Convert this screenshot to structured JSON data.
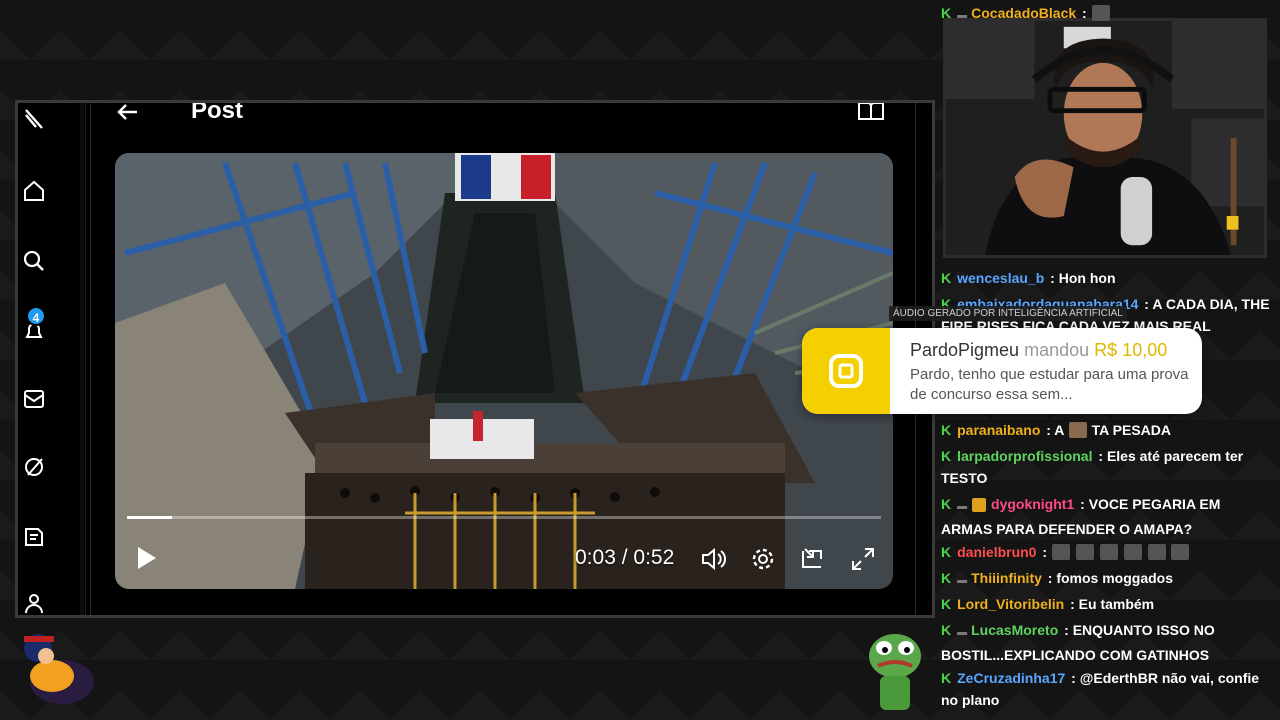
{
  "post": {
    "title": "Post",
    "notification_count": "4"
  },
  "video": {
    "current_time": "0:03",
    "duration": "0:52",
    "time_separator": " / ",
    "progress_fraction": 0.06
  },
  "alert": {
    "ai_label": "ÁUDIO GERADO POR INTELIGÊNCIA ARTIFICIAL",
    "sender": "PardoPigmeu",
    "verb": "mandou",
    "amount": "R$ 10,00",
    "message": "Pardo, tenho que estudar para uma prova de concurso essa sem..."
  },
  "chat": {
    "messages": [
      {
        "user": "CocadadoBlack",
        "color": "#f0b020",
        "text": "",
        "sub": true,
        "emotes": 1
      },
      {
        "user": "wenceslau_b",
        "color": "#58a6ff",
        "text": "Hon hon",
        "sub": false,
        "emotes": 0
      },
      {
        "user": "embaixadordaguanabara14",
        "color": "#58a6ff",
        "text": "A CADA DIA, THE FIRE RISES FICA CADA VEZ MAIS REAL",
        "sub": false,
        "emotes": 0
      },
      {
        "user": "paranaibano",
        "color": "#f0b020",
        "text": "TA PESADA",
        "text_prefix": "A",
        "sub": false,
        "emotes": 1
      },
      {
        "user": "larpadorprofissional",
        "color": "#5fd35f",
        "text": "Eles até parecem ter TESTO",
        "sub": false,
        "emotes": 0
      },
      {
        "user": "dygoknight1",
        "color": "#ff4a8a",
        "text": "VOCE PEGARIA EM ARMAS PARA DEFENDER O AMAPA?",
        "sub": true,
        "emotes": 0
      },
      {
        "user": "danielbrun0",
        "color": "#ff4d4d",
        "text": "",
        "sub": false,
        "emotes": 6
      },
      {
        "user": "Thiiinfinity",
        "color": "#f0b020",
        "text": "fomos moggados",
        "sub": true,
        "emotes": 0
      },
      {
        "user": "Lord_Vitoribelin",
        "color": "#f0b020",
        "text": "Eu também",
        "sub": false,
        "emotes": 0
      },
      {
        "user": "LucasMoreto",
        "color": "#5fd35f",
        "text": "ENQUANTO ISSO NO BOSTIL...EXPLICANDO COM GATINHOS",
        "sub": true,
        "emotes": 0
      },
      {
        "user": "ZeCruzadinha17",
        "color": "#58a6ff",
        "text": "@EderthBR não vai, confie no plano",
        "sub": false,
        "emotes": 0
      }
    ]
  },
  "colors": {
    "alert_accent": "#f5d000",
    "chat_badge": "#4ad64a",
    "notification_badge": "#1d9bf0"
  }
}
